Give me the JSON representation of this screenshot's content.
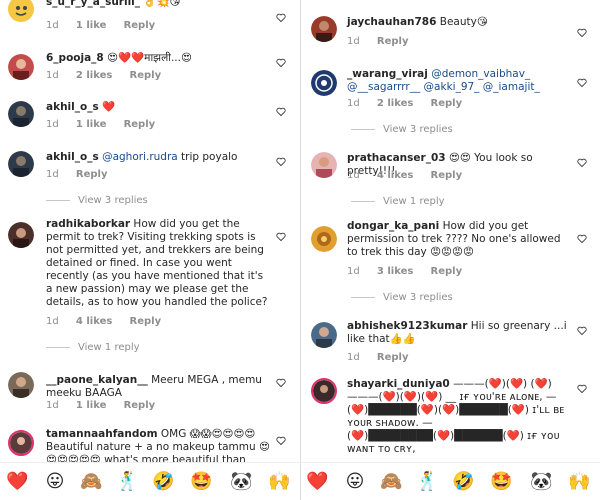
{
  "left": {
    "comments": [
      {
        "user": "s_u_r_y_a_suriii_",
        "text": "👌💥😘",
        "time": "1d",
        "likes": "1 like",
        "reply": "Reply"
      },
      {
        "user": "6_pooja_8",
        "text": "😍❤️❤️माझली...😍",
        "time": "1d",
        "likes": "2 likes",
        "reply": "Reply"
      },
      {
        "user": "akhil_o_s",
        "text": "❤️",
        "time": "1d",
        "likes": "1 like",
        "reply": "Reply"
      },
      {
        "user": "akhil_o_s",
        "mention": "@aghori.rudra",
        "text": " trip poyalo",
        "time": "1d",
        "reply": "Reply",
        "view_replies": "View 3 replies"
      },
      {
        "user": "radhikaborkar",
        "text": "How did you get the permit to trek? Visiting trekking spots is not permitted yet, and trekkers are being detained or fined. In case you went recently (as you have mentioned that it's a new passion) may we please get the details, as to how you handled the police?",
        "time": "1d",
        "likes": "4 likes",
        "reply": "Reply",
        "view_replies": "View 1 reply"
      },
      {
        "user": "__paone_kalyan__",
        "text": "Meeru MEGA , memu meeku BAAGA",
        "time": "1d",
        "likes": "1 like",
        "reply": "Reply"
      },
      {
        "user": "tamannaahfandom",
        "text": "OMG 😱😱😍😍😍😍 Beautiful nature + a no makeup tammu 😍😍😍😍😍😍 what's more beautiful than"
      }
    ]
  },
  "right": {
    "comments": [
      {
        "user": "jaychauhan786",
        "text": "Beauty😘",
        "time": "1d",
        "reply": "Reply"
      },
      {
        "user": "_warang_viraj",
        "mention": "@demon_vaibhav_ @__sagarrrr__ @akki_97_ @_iamajit_",
        "text": "",
        "time": "1d",
        "likes": "2 likes",
        "reply": "Reply",
        "view_replies": "View 3 replies"
      },
      {
        "user": "prathacanser_03",
        "text": "😍😍 You look so pretty!!!!",
        "time": "1d",
        "likes": "4 likes",
        "reply": "Reply",
        "view_replies": "View 1 reply"
      },
      {
        "user": "dongar_ka_pani",
        "text": "How did you get permission to trek ???? No one's allowed to trek this day 😡😡😡😡",
        "time": "1d",
        "likes": "3 likes",
        "reply": "Reply",
        "view_replies": "View 3 replies"
      },
      {
        "user": "abhishek9123kumar",
        "text": "Hii so greenary ...i like that👍👍",
        "time": "1d",
        "reply": "Reply"
      },
      {
        "user": "shayarki_duniya0",
        "text": "———(❤️)(❤️) (❤️)———(❤️)(❤️)(❤️) __ ɪғ ʏᴏᴜ'ʀᴇ ᴀʟᴏɴᴇ, —(❤️)██████(❤️)(❤️)██████(❤️) ɪ'ʟʟ ʙᴇ ʏᴏᴜʀ sʜᴀᴅᴏᴡ. —(❤️)████████(❤️)██████(❤️) ɪғ ʏᴏᴜ ᴡᴀɴᴛ ᴛᴏ ᴄʀʏ,"
      }
    ]
  },
  "emoji_bar": [
    "❤️",
    "😛",
    "🙈",
    "🕺",
    "🤣",
    "🤩",
    "🐼",
    "🙌",
    "❤️",
    "😛",
    "🙈",
    "🕺",
    "🤣",
    "🤩",
    "🐼",
    "🙌"
  ]
}
